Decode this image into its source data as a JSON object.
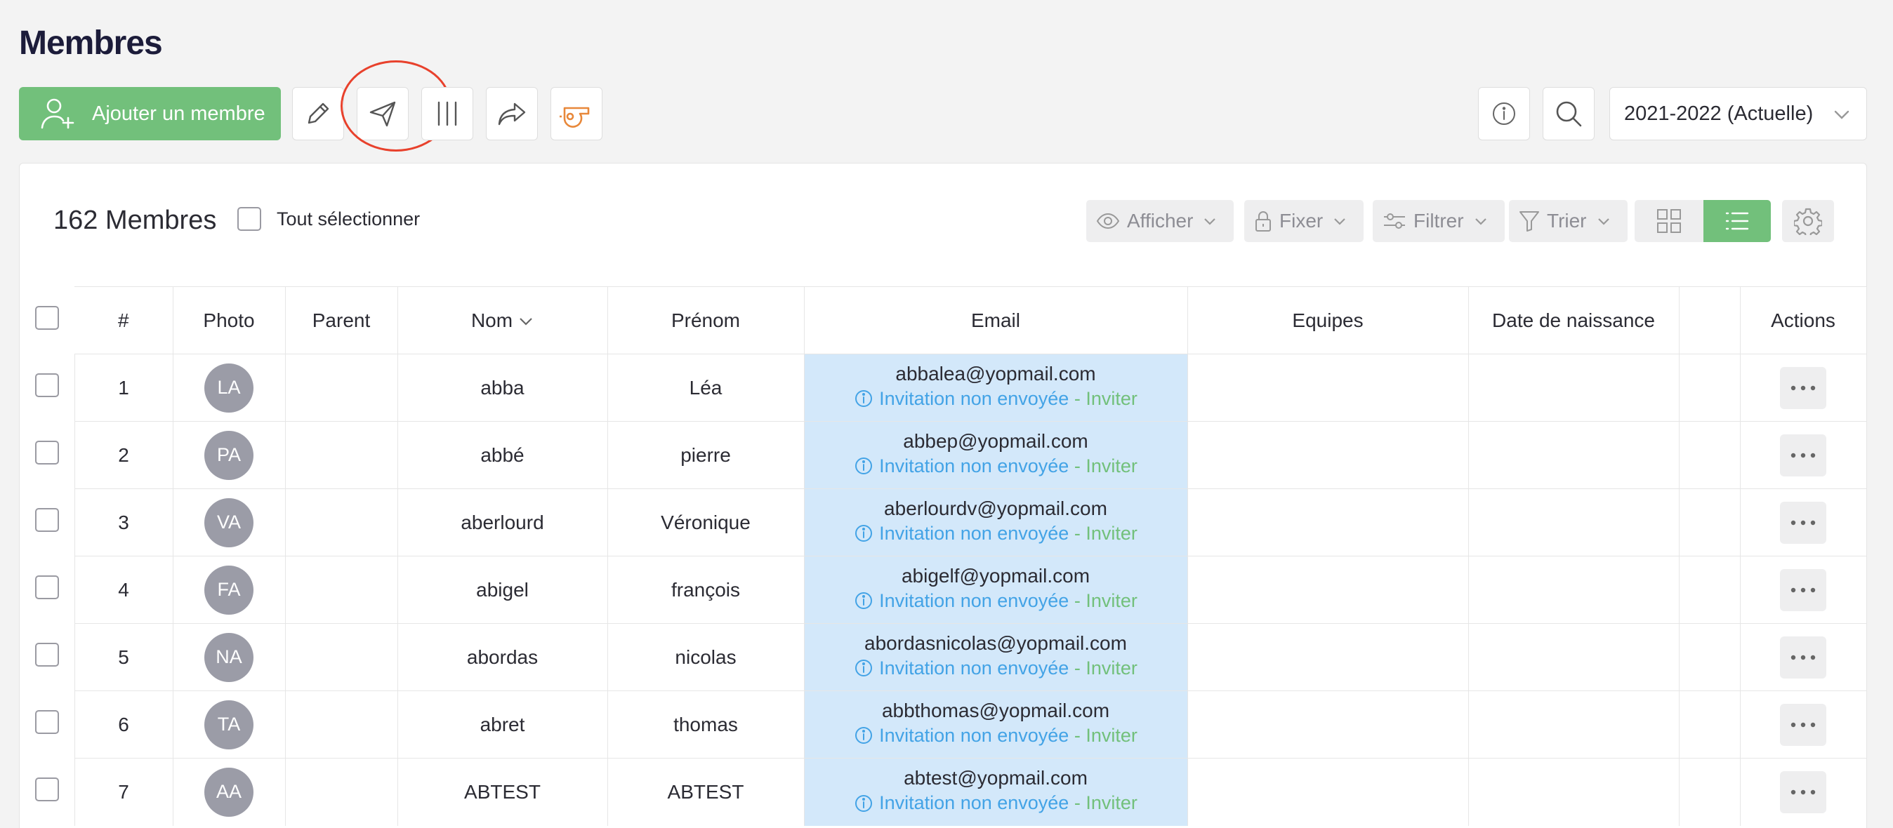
{
  "page": {
    "title": "Membres"
  },
  "toolbar": {
    "add_label": "Ajouter un membre",
    "season": "2021-2022 (Actuelle)"
  },
  "list": {
    "count_label": "162 Membres",
    "select_all": "Tout sélectionner",
    "controls": {
      "show": "Afficher",
      "pin": "Fixer",
      "filter": "Filtrer",
      "sort": "Trier"
    }
  },
  "table": {
    "headers": {
      "num": "#",
      "photo": "Photo",
      "parent": "Parent",
      "nom": "Nom",
      "prenom": "Prénom",
      "email": "Email",
      "equipes": "Equipes",
      "naissance": "Date de naissance",
      "actions": "Actions"
    },
    "invite_text": "Invitation non envoyée",
    "invite_sep": " - ",
    "invite_link": "Inviter",
    "rows": [
      {
        "num": "1",
        "initials": "LA",
        "parent": "",
        "nom": "abba",
        "prenom": "Léa",
        "email": "abbalea@yopmail.com",
        "equipes": "",
        "naissance": ""
      },
      {
        "num": "2",
        "initials": "PA",
        "parent": "",
        "nom": "abbé",
        "prenom": "pierre",
        "email": "abbep@yopmail.com",
        "equipes": "",
        "naissance": ""
      },
      {
        "num": "3",
        "initials": "VA",
        "parent": "",
        "nom": "aberlourd",
        "prenom": "Véronique",
        "email": "aberlourdv@yopmail.com",
        "equipes": "",
        "naissance": ""
      },
      {
        "num": "4",
        "initials": "FA",
        "parent": "",
        "nom": "abigel",
        "prenom": "françois",
        "email": "abigelf@yopmail.com",
        "equipes": "",
        "naissance": ""
      },
      {
        "num": "5",
        "initials": "NA",
        "parent": "",
        "nom": "abordas",
        "prenom": "nicolas",
        "email": "abordasnicolas@yopmail.com",
        "equipes": "",
        "naissance": ""
      },
      {
        "num": "6",
        "initials": "TA",
        "parent": "",
        "nom": "abret",
        "prenom": "thomas",
        "email": "abbthomas@yopmail.com",
        "equipes": "",
        "naissance": ""
      },
      {
        "num": "7",
        "initials": "AA",
        "parent": "",
        "nom": "ABTEST",
        "prenom": "ABTEST",
        "email": "abtest@yopmail.com",
        "equipes": "",
        "naissance": ""
      }
    ]
  },
  "colors": {
    "accent": "#72c07b",
    "link": "#43a3e6",
    "highlight": "#e8412c",
    "email_bg": "#d3e8fa"
  }
}
